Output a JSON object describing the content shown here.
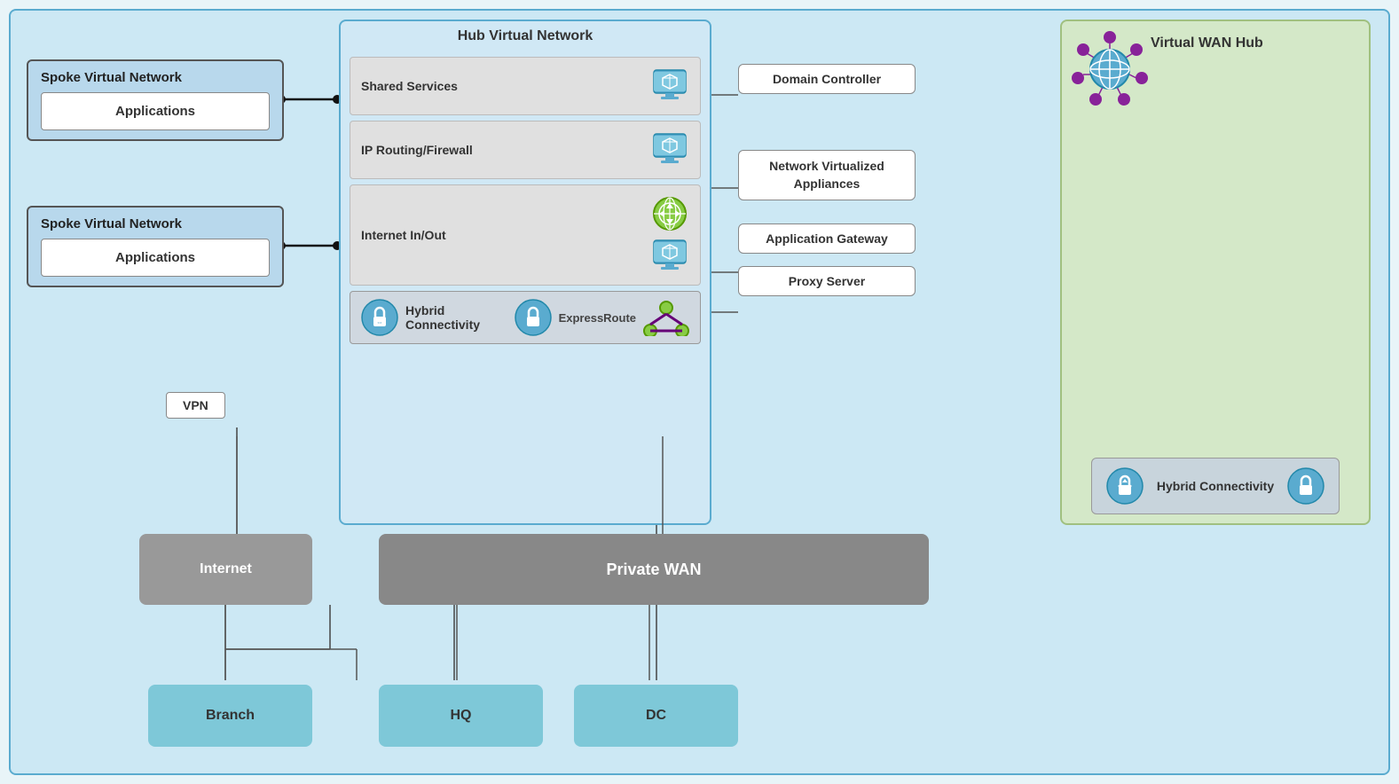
{
  "spoke1": {
    "title": "Spoke Virtual Network",
    "inner": "Applications"
  },
  "spoke2": {
    "title": "Spoke Virtual Network",
    "inner": "Applications"
  },
  "hub": {
    "title": "Hub Virtual Network",
    "services": [
      {
        "label": "Shared Services",
        "icon": "monitor"
      },
      {
        "label": "IP Routing/Firewall",
        "icon": "monitor"
      },
      {
        "label": "Internet In/Out",
        "icon": "routing"
      }
    ],
    "hybrid": "Hybrid Connectivity"
  },
  "right_labels": {
    "domain_controller": "Domain Controller",
    "network_virtualized": "Network  Virtualized\nAppliances",
    "application_gateway": "Application Gateway",
    "proxy_server": "Proxy Server",
    "express_route": "ExpressRoute"
  },
  "vpn": "VPN",
  "internet": "Internet",
  "private_wan": "Private WAN",
  "branch": "Branch",
  "hq": "HQ",
  "dc": "DC",
  "vwan": {
    "title": "Virtual WAN Hub",
    "hybrid": "Hybrid Connectivity"
  }
}
